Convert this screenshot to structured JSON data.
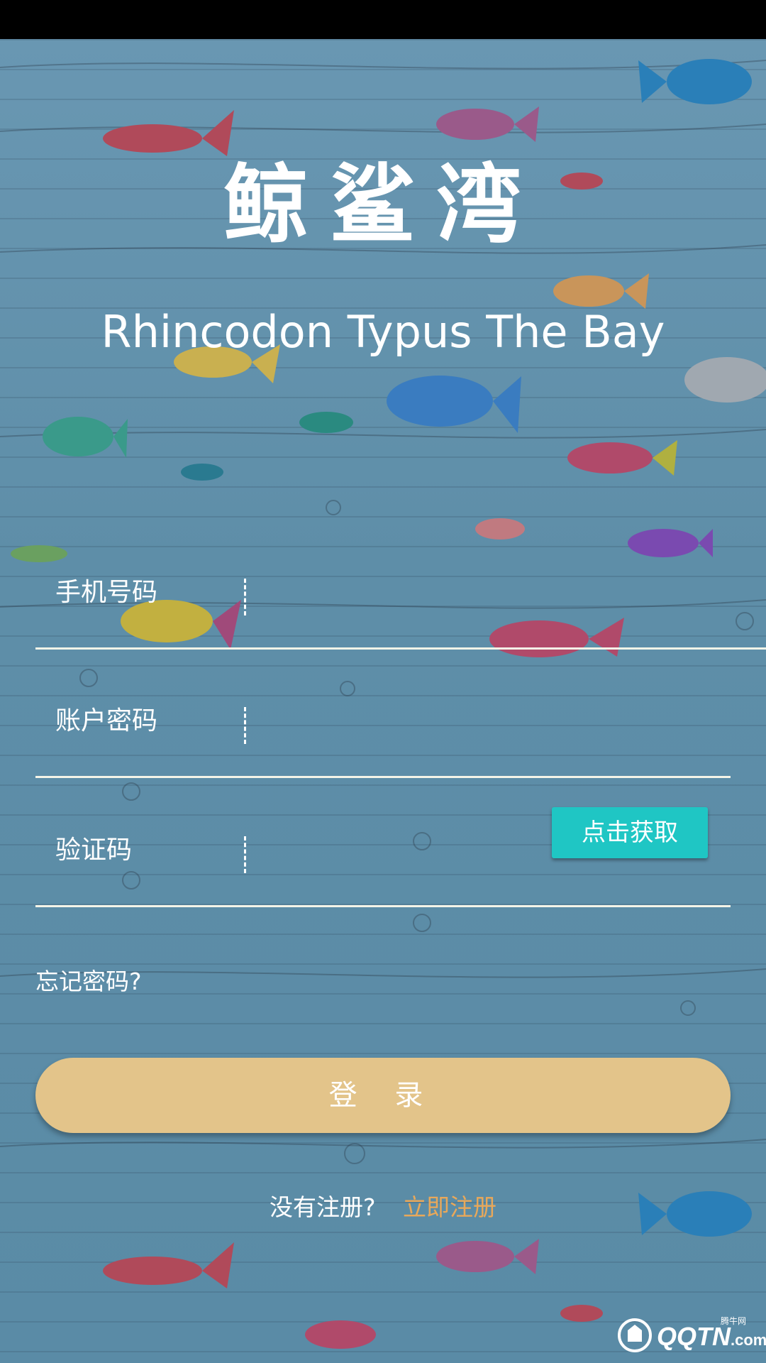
{
  "app": {
    "title": "鲸鲨湾",
    "subtitle": "Rhincodon Typus The Bay"
  },
  "form": {
    "phone_label": "手机号码",
    "password_label": "账户密码",
    "code_label": "验证码",
    "phone_value": "",
    "password_value": "",
    "code_value": "",
    "get_code_label": "点击获取"
  },
  "forgot_password_label": "忘记密码?",
  "login_label": "登 录",
  "register": {
    "prompt": "没有注册?",
    "link": "立即注册"
  },
  "watermark": {
    "text": "QQTN",
    "suffix": ".com",
    "small": "腾牛网"
  },
  "colors": {
    "background": "#5f8ea8",
    "get_code_button": "#1fc6c4",
    "login_button": "#e3c48a",
    "register_link": "#e8a85a"
  }
}
